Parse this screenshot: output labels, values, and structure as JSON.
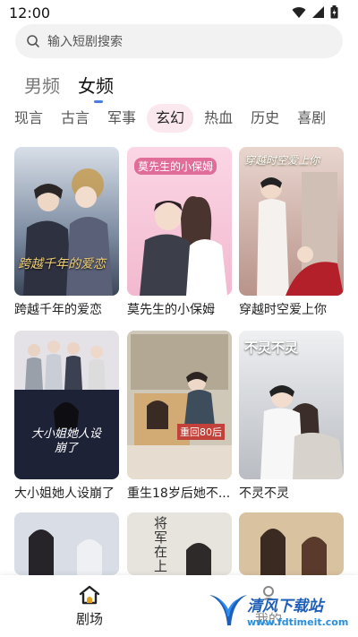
{
  "status": {
    "time": "12:00"
  },
  "search": {
    "placeholder": "输入短剧搜索"
  },
  "gender_tabs": [
    {
      "label": "男频",
      "active": false
    },
    {
      "label": "女频",
      "active": true
    }
  ],
  "genre_tabs": [
    {
      "label": "现言"
    },
    {
      "label": "古言"
    },
    {
      "label": "军事"
    },
    {
      "label": "玄幻",
      "active": true
    },
    {
      "label": "热血"
    },
    {
      "label": "历史"
    },
    {
      "label": "喜剧"
    }
  ],
  "dramas": [
    {
      "title": "跨越千年的爱恋",
      "poster_text": "跨越千年的爱恋"
    },
    {
      "title": "莫先生的小保姆",
      "poster_text": "莫先生的小保姆"
    },
    {
      "title": "穿越时空爱上你",
      "poster_text": "穿越时空爱上你"
    },
    {
      "title": "大小姐她人设崩了",
      "poster_text": "大小姐她人设崩了"
    },
    {
      "title": "重生18岁后她不...",
      "poster_text": "重回80后"
    },
    {
      "title": "不灵不灵",
      "poster_text": "不灵不灵"
    },
    {
      "title": "",
      "poster_text": ""
    },
    {
      "title": "",
      "poster_text": "将军在上"
    },
    {
      "title": "",
      "poster_text": ""
    }
  ],
  "bottom_nav": {
    "theater_label": "剧场",
    "mine_label": "我的"
  },
  "watermark": {
    "line1": "清风下载站",
    "line2": "www.fdtimeit.com"
  },
  "colors": {
    "accent": "#4a7ee0",
    "active_genre_bg": "#fbe8ee",
    "nav_icon": "#e0a020"
  }
}
